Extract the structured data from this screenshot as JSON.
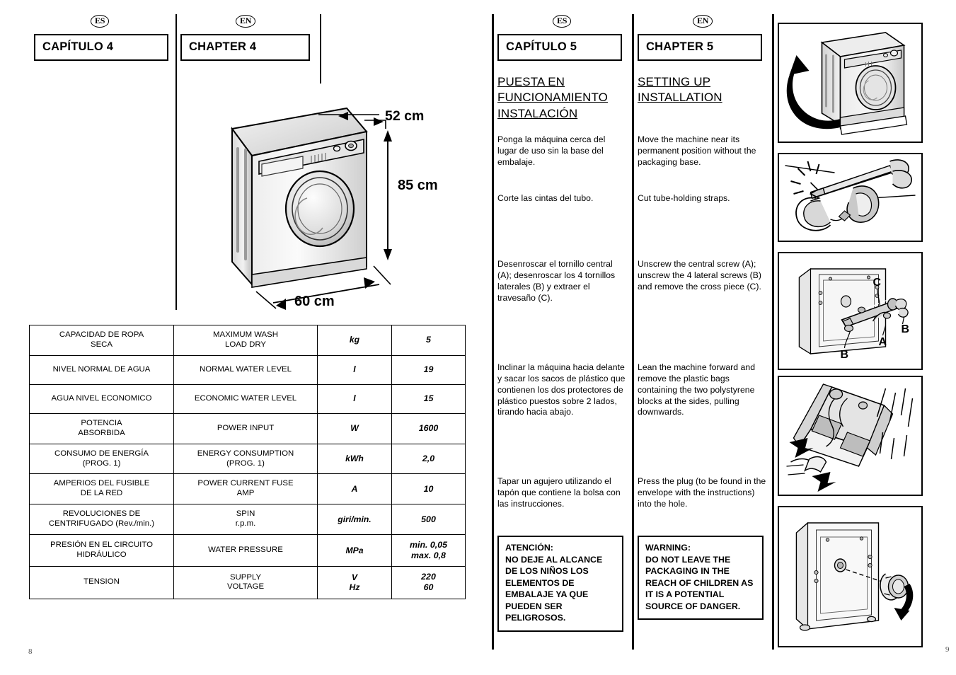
{
  "left_page": {
    "page_number": "8",
    "lang_es": "ES",
    "lang_en": "EN",
    "chapter_es": "CAPÍTULO 4",
    "chapter_en": "CHAPTER 4",
    "figure": {
      "name": "washing-machine-dimensions",
      "depth": "52 cm",
      "height": "85 cm",
      "width": "60 cm"
    },
    "spec_table": {
      "rows": [
        {
          "es": "CAPACIDAD DE ROPA\nSECA",
          "en": "MAXIMUM WASH\nLOAD DRY",
          "unit": "kg",
          "value": "5"
        },
        {
          "es": "NIVEL NORMAL DE AGUA",
          "en": "NORMAL WATER LEVEL",
          "unit": "l",
          "value": "19"
        },
        {
          "es": "AGUA NIVEL ECONOMICO",
          "en": "ECONOMIC WATER LEVEL",
          "unit": "l",
          "value": "15"
        },
        {
          "es": "POTENCIA\nABSORBIDA",
          "en": "POWER INPUT",
          "unit": "W",
          "value": "1600"
        },
        {
          "es": "CONSUMO DE ENERGÍA\n(PROG. 1)",
          "en": "ENERGY CONSUMPTION\n(PROG. 1)",
          "unit": "kWh",
          "value": "2,0"
        },
        {
          "es": "AMPERIOS DEL FUSIBLE\nDE LA RED",
          "en": "POWER CURRENT FUSE\nAMP",
          "unit": "A",
          "value": "10"
        },
        {
          "es": "REVOLUCIONES DE\nCENTRIFUGADO (Rev./min.)",
          "en": "SPIN\nr.p.m.",
          "unit": "giri/min.",
          "value": "500"
        },
        {
          "es": "PRESIÓN EN EL CIRCUITO\nHIDRÁULICO",
          "en": "WATER PRESSURE",
          "unit": "MPa",
          "value": "min. 0,05\nmax. 0,8"
        },
        {
          "es": "TENSION",
          "en": "SUPPLY\nVOLTAGE",
          "unit": "V\nHz",
          "value": "220\n60"
        }
      ]
    }
  },
  "right_page": {
    "page_number": "9",
    "lang_es": "ES",
    "lang_en": "EN",
    "chapter_es": "CAPÍTULO 5",
    "chapter_en": "CHAPTER 5",
    "heading_es": "PUESTA EN\nFUNCIONAMIENTO\nINSTALACIÓN",
    "heading_en": "SETTING UP\nINSTALLATION",
    "steps_es": [
      "Ponga la máquina cerca del lugar de uso sin la base del embalaje.",
      "Corte las cintas del tubo.",
      "Desenroscar el tornillo central (A); desenroscar los 4 tornillos laterales (B) y extraer el travesaño (C).",
      "Inclinar la máquina hacia delante y sacar los sacos de plástico que contienen los dos protectores de plástico puestos sobre 2 lados, tirando hacia abajo.",
      "Tapar un agujero utilizando el tapón que contiene la bolsa con las instrucciones."
    ],
    "steps_en": [
      "Move the machine near its permanent position without the packaging base.",
      "Cut tube-holding straps.",
      "Unscrew the central screw (A); unscrew the 4 lateral screws (B) and remove the cross piece (C).",
      "Lean the machine forward and remove the plastic bags containing the two polystyrene blocks at the sides, pulling downwards.",
      "Press the plug (to be found in the envelope with the instructions) into the hole."
    ],
    "warning_es": "ATENCIÓN:\nNO DEJE AL ALCANCE\nDE LOS NIÑOS LOS\nELEMENTOS DE\nEMBALAJE YA QUE\nPUEDEN SER\nPELIGROSOS.",
    "warning_en": "WARNING:\nDO NOT LEAVE THE\nPACKAGING IN THE\nREACH OF CHILDREN AS\nIT IS A POTENTIAL\nSOURCE OF DANGER.",
    "illustrations": [
      {
        "name": "machine-remove-base",
        "labels": []
      },
      {
        "name": "cut-straps-scissors",
        "labels": []
      },
      {
        "name": "unscrew-transit-bolts",
        "labels": [
          "C",
          "B",
          "A",
          "B"
        ]
      },
      {
        "name": "tilt-machine-remove-bags",
        "labels": []
      },
      {
        "name": "insert-plug-into-hole",
        "labels": []
      }
    ]
  }
}
